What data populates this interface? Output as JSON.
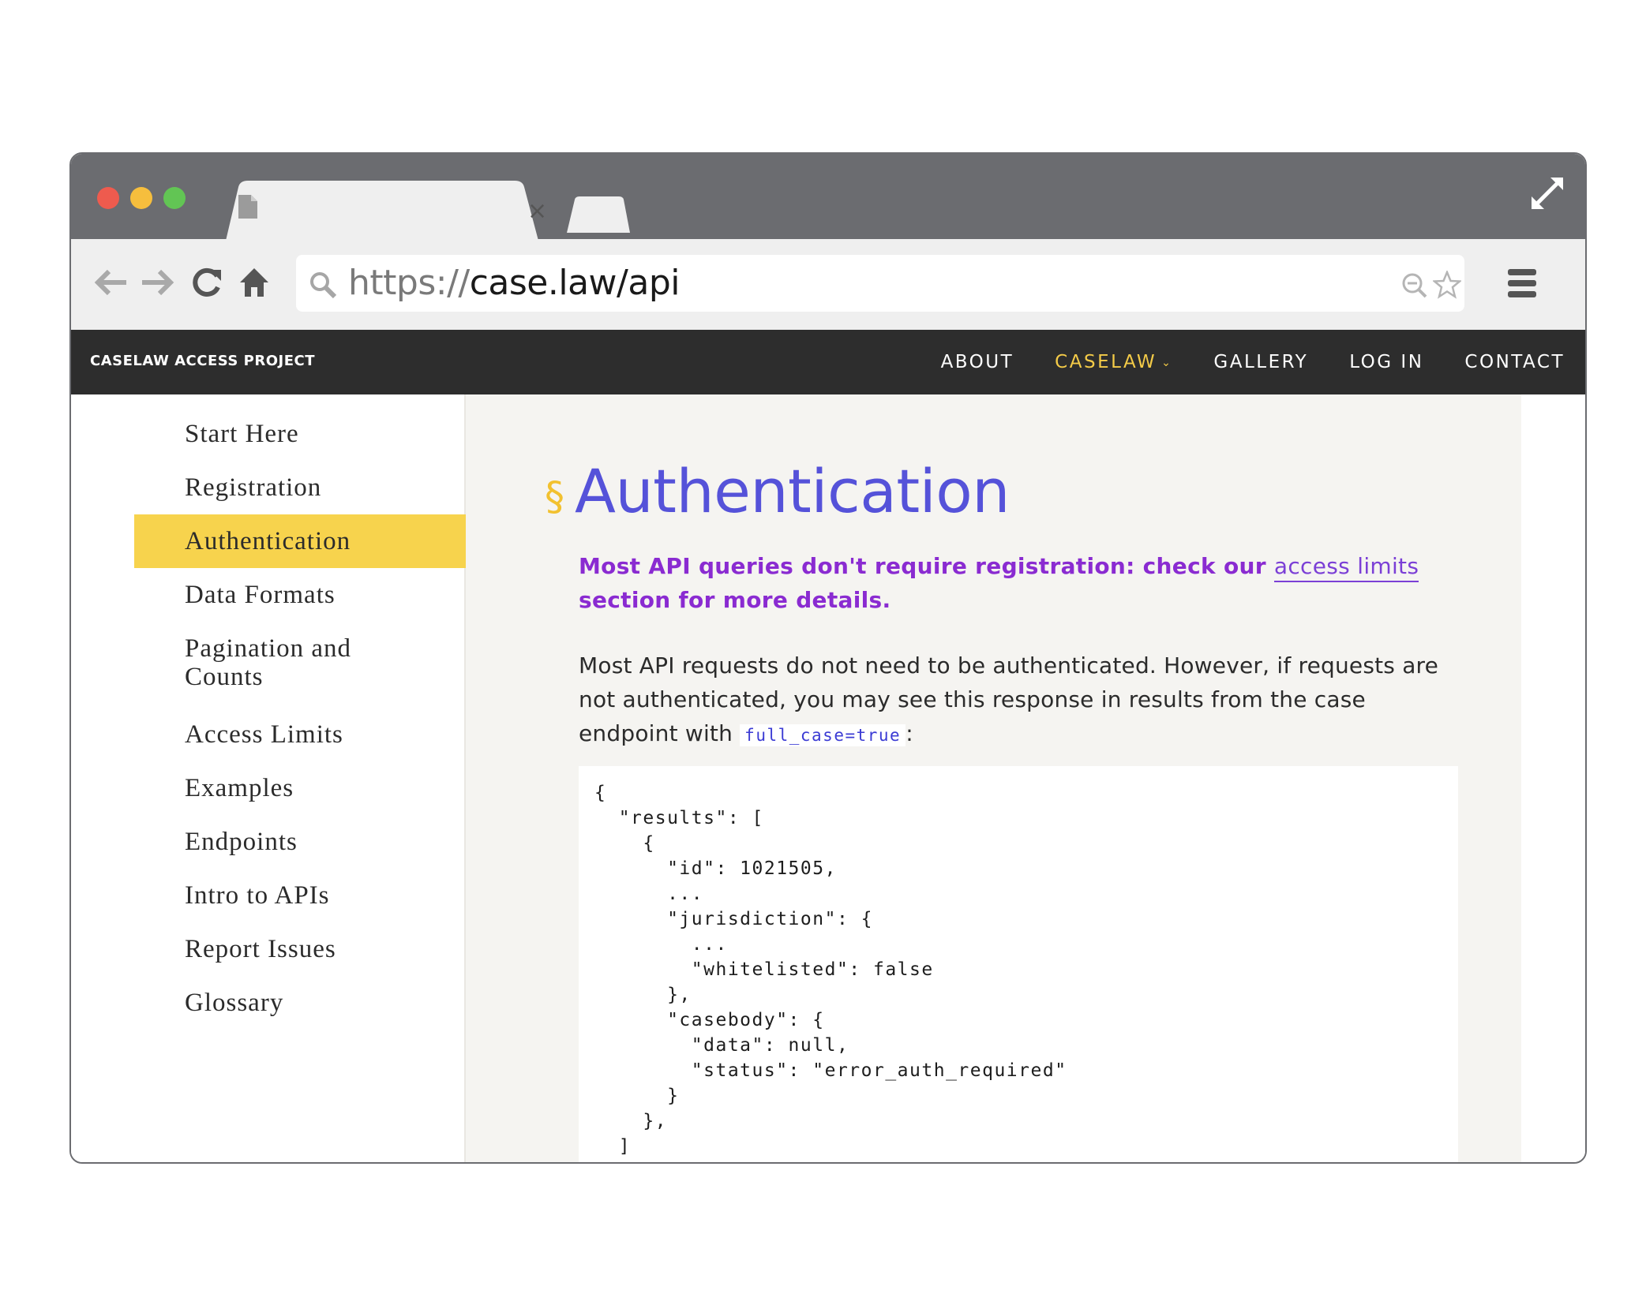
{
  "browser": {
    "url_scheme": "https://",
    "url_host": "case.law/api",
    "icons": [
      "back-icon",
      "forward-icon",
      "reload-icon",
      "home-icon",
      "search-icon",
      "zoom-out-icon",
      "star-icon",
      "menu-icon",
      "expand-icon",
      "close-icon",
      "file-icon"
    ]
  },
  "sitenav": {
    "brand": "CASELAW ACCESS PROJECT",
    "links": [
      {
        "label": "ABOUT"
      },
      {
        "label": "CASELAW"
      },
      {
        "label": "GALLERY"
      },
      {
        "label": "LOG IN"
      },
      {
        "label": "CONTACT"
      }
    ],
    "active_color": "#f4cb48"
  },
  "sidebar": {
    "items": [
      {
        "label": "Start Here"
      },
      {
        "label": "Registration"
      },
      {
        "label": "Authentication"
      },
      {
        "label": "Data Formats"
      },
      {
        "label": "Pagination and Counts"
      },
      {
        "label": "Access Limits"
      },
      {
        "label": "Examples"
      },
      {
        "label": "Endpoints"
      },
      {
        "label": "Intro to APIs"
      },
      {
        "label": "Report Issues"
      },
      {
        "label": "Glossary"
      }
    ],
    "active_color": "#f7d34d"
  },
  "main": {
    "section_mark": "§",
    "heading": "Authentication",
    "callout": {
      "before": "Most API queries don't require registration: check our ",
      "link": "access limits",
      "after": " section for more details."
    },
    "para": {
      "text": "Most API requests do not need to be authenticated. However, if requests are not authenticated, you may see this response in results from the case endpoint with ",
      "code": "full_case=true",
      "after": ":"
    },
    "code": "{\n  \"results\": [\n    {\n      \"id\": 1021505,\n      ...\n      \"jurisdiction\": {\n        ...\n        \"whitelisted\": false\n      },\n      \"casebody\": {\n        \"data\": null,\n        \"status\": \"error_auth_required\"\n      }\n    },\n  ]"
  },
  "colors": {
    "heading": "#5552d9",
    "callout": "#8a2bd1",
    "section_mark": "#f2c12f"
  }
}
